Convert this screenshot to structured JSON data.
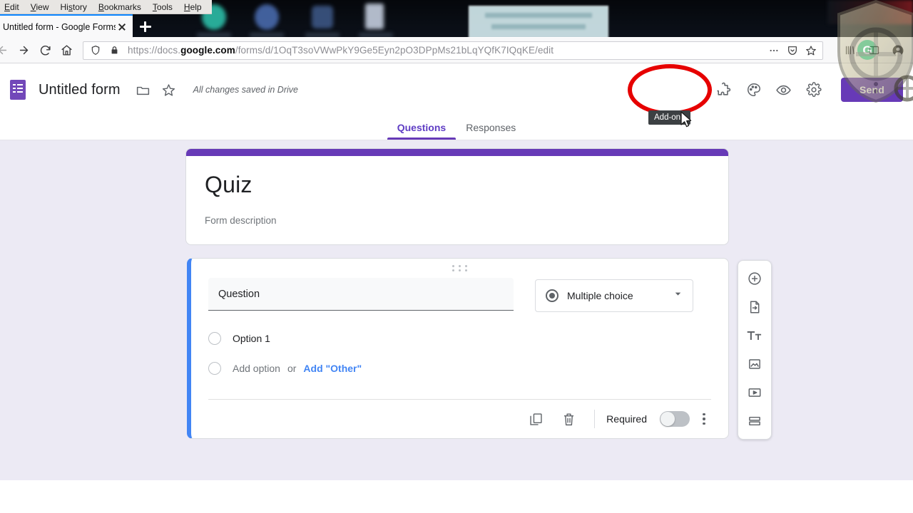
{
  "browser": {
    "menu_items": [
      {
        "label": "Edit",
        "accel": "E"
      },
      {
        "label": "View",
        "accel": "V"
      },
      {
        "label": "History",
        "accel": "s"
      },
      {
        "label": "Bookmarks",
        "accel": "B"
      },
      {
        "label": "Tools",
        "accel": "T"
      },
      {
        "label": "Help",
        "accel": "H"
      }
    ],
    "tab": {
      "title": "Untitled form - Google Forms",
      "close_icon": "close-icon",
      "newtab_icon": "plus-icon"
    },
    "nav": {
      "back_icon": "back-arrow-icon",
      "forward_icon": "forward-arrow-icon",
      "reload_icon": "reload-icon",
      "home_icon": "home-icon"
    },
    "url": {
      "scheme": "https://docs.",
      "domain": "google.com",
      "path": "/forms/d/1OqT3soVWwPkY9Ge5Eyn2pO3DPpMs21bLqYQfK7IQqKE/edit",
      "full": "https://docs.google.com/forms/d/1OqT3soVWwPkY9Ge5Eyn2pO3DPpMs21bLqYQfK7IQqKE/edit",
      "shield_icon": "tracking-protection-shield-icon",
      "lock_icon": "padlock-icon",
      "page_actions_icon": "ellipsis-icon",
      "pocket_icon": "pocket-save-icon",
      "bookmark_icon": "bookmark-star-icon"
    },
    "toolbar_right": {
      "library_icon": "library-icon",
      "sidebar_icon": "sidebar-toggle-icon",
      "account_icon": "account-avatar-icon"
    }
  },
  "app": {
    "logo_icon": "google-forms-logo-icon",
    "title": "Untitled form",
    "move_folder_icon": "folder-icon",
    "star_icon": "star-outline-icon",
    "save_status": "All changes saved in Drive",
    "actions": {
      "addons_icon": "puzzle-piece-addons-icon",
      "theme_icon": "color-palette-icon",
      "preview_icon": "eye-preview-icon",
      "settings_icon": "gear-settings-icon",
      "send_label": "Send"
    },
    "tabs": [
      {
        "label": "Questions",
        "active": true
      },
      {
        "label": "Responses",
        "active": false
      }
    ]
  },
  "form": {
    "title": "Quiz",
    "description_placeholder": "Form description",
    "accent_color": "#673ab7"
  },
  "question": {
    "drag_handle_icon": "drag-handle-icon",
    "text": "Question",
    "type": {
      "label": "Multiple choice",
      "radio_icon": "radio-filled-icon",
      "chevron_icon": "chevron-down-icon"
    },
    "options": [
      {
        "label": "Option 1",
        "radio_icon": "radio-empty-icon"
      }
    ],
    "add_option_label": "Add option",
    "or_label": "or",
    "add_other_label": "Add \"Other\"",
    "footer": {
      "duplicate_icon": "duplicate-icon",
      "delete_icon": "trash-icon",
      "required_label": "Required",
      "required_on": false,
      "more_icon": "kebab-menu-icon"
    },
    "accent_color": "#4285f4"
  },
  "side_toolbar": [
    {
      "name": "add-question",
      "icon": "circle-plus-icon"
    },
    {
      "name": "import-questions",
      "icon": "import-file-icon"
    },
    {
      "name": "add-title-description",
      "icon": "text-tt-icon"
    },
    {
      "name": "add-image",
      "icon": "image-icon"
    },
    {
      "name": "add-video",
      "icon": "video-icon"
    },
    {
      "name": "add-section",
      "icon": "section-icon"
    }
  ],
  "annotations": {
    "tooltip_text": "Add-ons",
    "highlight_color": "#e60000",
    "cursor_icon": "mouse-pointer-icon",
    "watermark_icon": "shield-logo-watermark-icon"
  }
}
